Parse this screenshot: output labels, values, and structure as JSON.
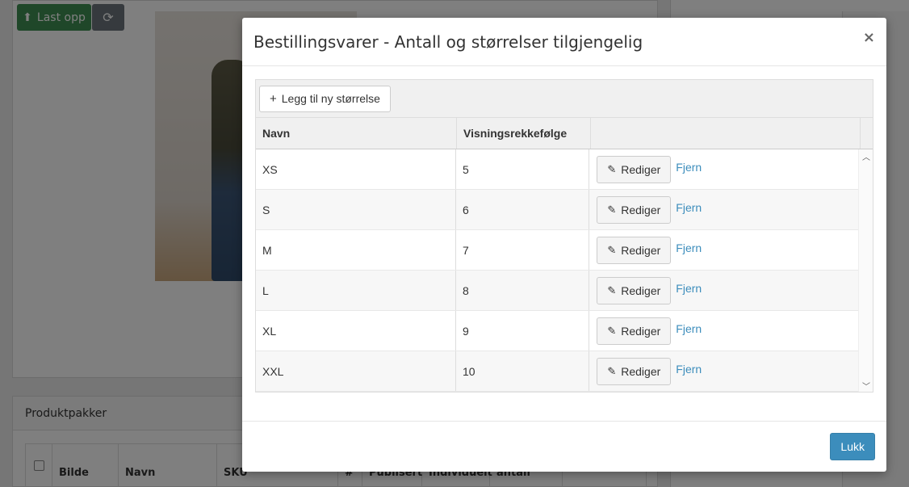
{
  "background": {
    "upload_label": "Last opp",
    "pakker_title": "Produktpakker",
    "pakker_columns": [
      "Bilde",
      "Navn",
      "SKU",
      "#",
      "Publisert",
      "Individuelt",
      "antall"
    ]
  },
  "modal": {
    "title": "Bestillingsvarer - Antall og størrelser tilgjengelig",
    "close_symbol": "×",
    "add_size_label": "Legg til ny størrelse",
    "columns": {
      "name": "Navn",
      "order": "Visningsrekkefølge",
      "actions": ""
    },
    "rows": [
      {
        "name": "XS",
        "order": "5"
      },
      {
        "name": "S",
        "order": "6"
      },
      {
        "name": "M",
        "order": "7"
      },
      {
        "name": "L",
        "order": "8"
      },
      {
        "name": "XL",
        "order": "9"
      },
      {
        "name": "XXL",
        "order": "10"
      }
    ],
    "edit_label": "Rediger",
    "remove_label": "Fjern",
    "footer_close_label": "Lukk"
  },
  "colors": {
    "primary": "#3c8dbc",
    "success": "#3f8f53",
    "link": "#3c8dbc"
  }
}
